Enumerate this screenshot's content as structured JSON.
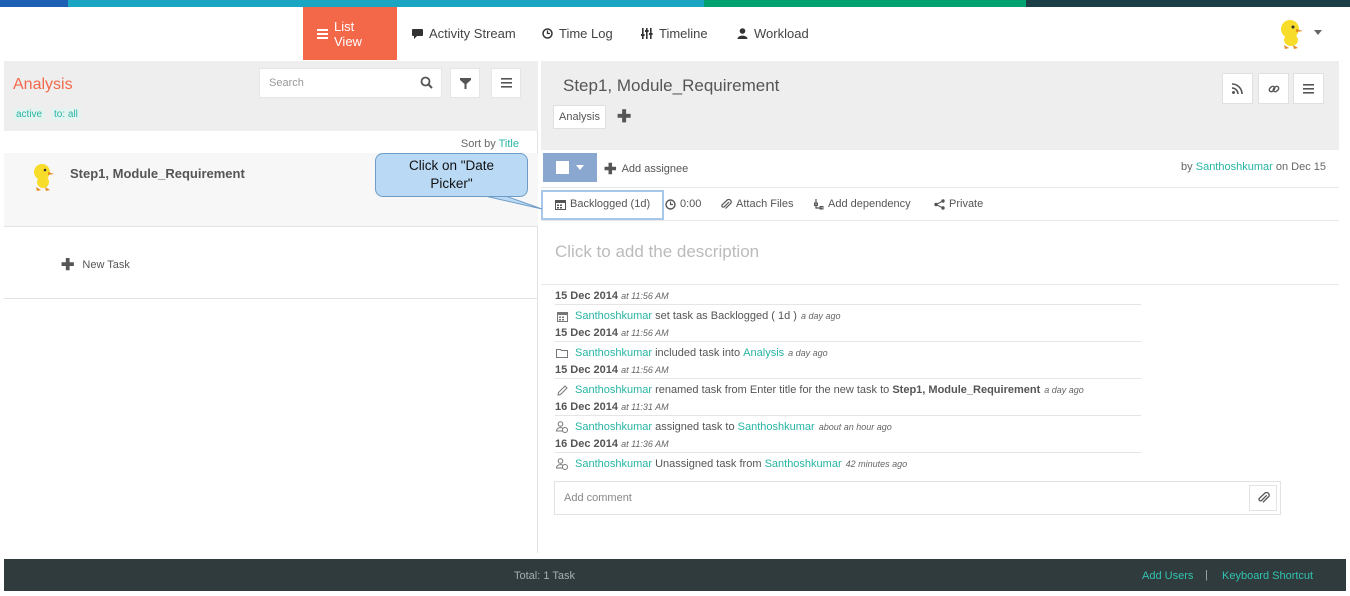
{
  "colors": {
    "stripe": [
      "#1d5fb5",
      "#1aa6c2",
      "#00a36f",
      "#1c3e47"
    ],
    "accent": "#f4684a",
    "link": "#27b5a4"
  },
  "nav": {
    "items": [
      {
        "label": "List View",
        "icon": "list-icon"
      },
      {
        "label": "Activity Stream",
        "icon": "speech-bubble-icon"
      },
      {
        "label": "Time Log",
        "icon": "clock-icon"
      },
      {
        "label": "Timeline",
        "icon": "sliders-icon"
      },
      {
        "label": "Workload",
        "icon": "user-icon"
      }
    ]
  },
  "left": {
    "project_title": "Analysis",
    "filters": [
      "active",
      "to: all"
    ],
    "search_placeholder": "Search",
    "sort_label": "Sort by",
    "sort_value": "Title",
    "task_name": "Step1, Module_Requirement",
    "new_task_label": "New Task"
  },
  "task": {
    "title": "Step1, Module_Requirement",
    "tag": "Analysis",
    "add_assignee": "Add assignee",
    "by_prefix": "by",
    "by_user": "Santhoshkumar",
    "by_suffix": "on Dec 15",
    "tools": {
      "status": "Backlogged (1d)",
      "time": "0:00",
      "attach": "Attach Files",
      "dependency": "Add dependency",
      "private": "Private"
    },
    "description_placeholder": "Click to add the description"
  },
  "activity": [
    {
      "date": "15 Dec 2014",
      "time": "at 11:56 AM",
      "icon": "calendar-icon",
      "user": "Santhoshkumar",
      "text": "set task as Backlogged ( 1d )",
      "ago": "a day ago"
    },
    {
      "date": "15 Dec 2014",
      "time": "at 11:56 AM",
      "icon": "folder-icon",
      "user": "Santhoshkumar",
      "text": "included task into",
      "target": "Analysis",
      "ago": "a day ago"
    },
    {
      "date": "15 Dec 2014",
      "time": "at 11:56 AM",
      "icon": "pencil-icon",
      "user": "Santhoshkumar",
      "text": "renamed task from Enter title for the new task to",
      "bold": "Step1, Module_Requirement",
      "ago": "a day ago"
    },
    {
      "date": "16 Dec 2014",
      "time": "at 11:31 AM",
      "icon": "assign-user-icon",
      "user": "Santhoshkumar",
      "text": "assigned task to",
      "target": "Santhoshkumar",
      "ago": "about an hour ago"
    },
    {
      "date": "16 Dec 2014",
      "time": "at 11:36 AM",
      "icon": "assign-user-icon",
      "user": "Santhoshkumar",
      "text": "Unassigned task from",
      "target": "Santhoshkumar",
      "ago": "42 minutes ago"
    }
  ],
  "comment_placeholder": "Add comment",
  "callout": {
    "line1": "Click on \"Date",
    "line2": "Picker\""
  },
  "footer": {
    "total": "Total: 1 Task",
    "add_users": "Add Users",
    "separator": "|",
    "shortcut": "Keyboard Shortcut"
  }
}
